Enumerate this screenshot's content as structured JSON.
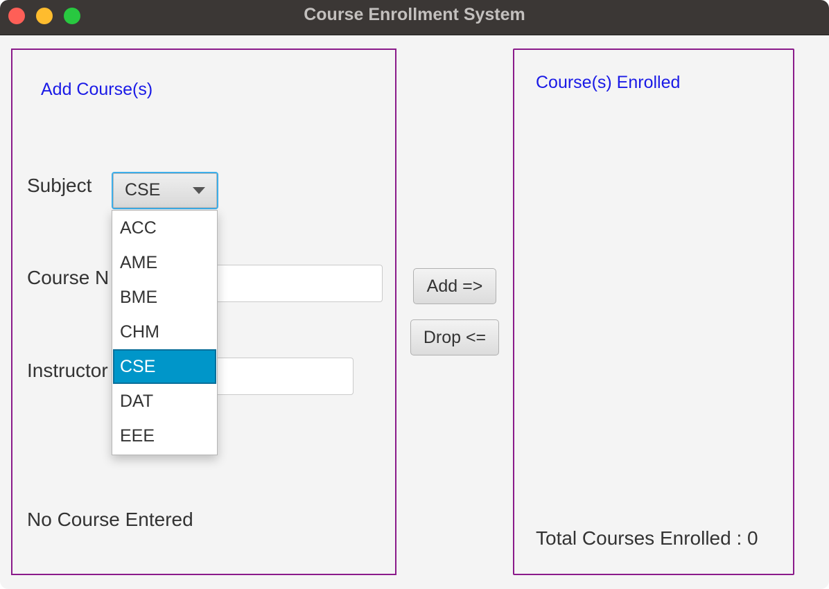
{
  "window": {
    "title": "Course Enrollment System"
  },
  "left_panel": {
    "heading": "Add Course(s)",
    "subject_label": "Subject",
    "course_number_label": "Course N",
    "instructor_label": "Instructor",
    "subject_combo": {
      "selected": "CSE",
      "options": [
        "ACC",
        "AME",
        "BME",
        "CHM",
        "CSE",
        "DAT",
        "EEE"
      ],
      "highlighted_index": 4
    },
    "course_number_value": "",
    "instructor_value": "",
    "status_text": "No Course Entered"
  },
  "buttons": {
    "add_label": "Add =>",
    "drop_label": "Drop <="
  },
  "right_panel": {
    "heading": "Course(s) Enrolled",
    "total_label": "Total Courses Enrolled : 0"
  },
  "colors": {
    "panel_border": "#8a1a8a",
    "heading": "#1a1ae6",
    "selection": "#0096c9",
    "focus": "#3daee9"
  }
}
